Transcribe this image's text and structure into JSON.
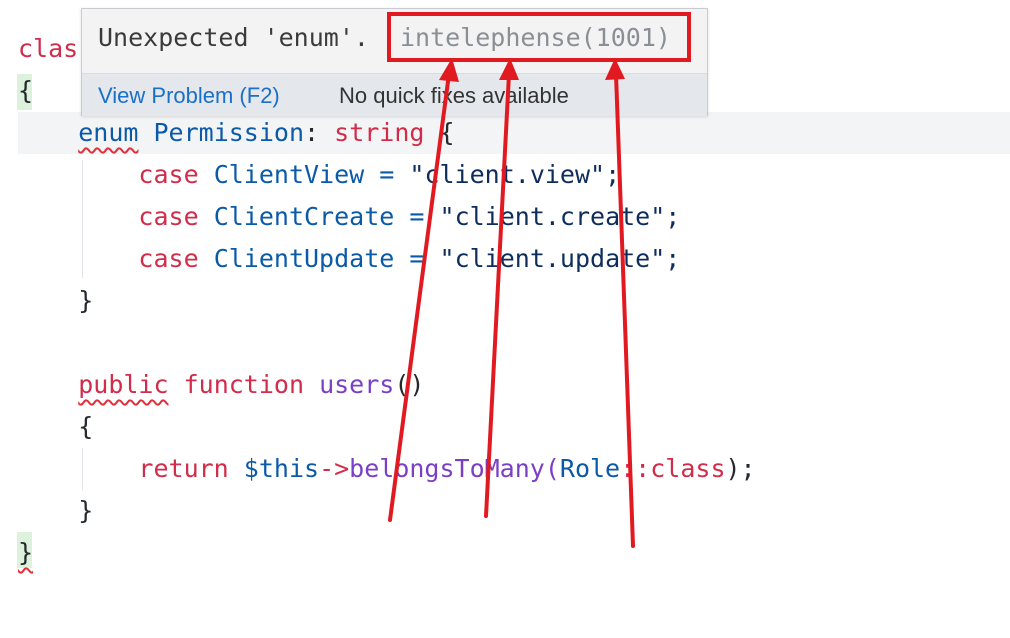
{
  "code": {
    "line_class_partial": "clas",
    "open_brace": "{",
    "enum_kw": "enum",
    "enum_name": "Permission",
    "enum_colon": ":",
    "enum_type": "string",
    "enum_open": "{",
    "cases": [
      {
        "kw": "case",
        "name": "ClientView",
        "eq": "=",
        "value": "\"client.view\";"
      },
      {
        "kw": "case",
        "name": "ClientCreate",
        "eq": "=",
        "value": "\"client.create\";"
      },
      {
        "kw": "case",
        "name": "ClientUpdate",
        "eq": "=",
        "value": "\"client.update\";"
      }
    ],
    "enum_close": "}",
    "public_kw": "public",
    "function_kw": "function",
    "method_name": "users",
    "method_parens": "()",
    "method_open": "{",
    "return_kw": "return",
    "this_var": "$this",
    "arrow_op": "->",
    "call_name": "belongsToMany",
    "paren_open": "(",
    "role_class": "Role",
    "scope_op": "::",
    "class_kw": "class",
    "paren_close": ");",
    "method_close": "}",
    "class_close": "}"
  },
  "hover": {
    "message": "Unexpected 'enum'.",
    "source": "intelephense(1001)",
    "view_problem": "View Problem (F2)",
    "no_fixes": "No quick fixes available"
  },
  "annotation": {
    "box_color": "#e11a22",
    "arrow_color": "#e11a22"
  }
}
